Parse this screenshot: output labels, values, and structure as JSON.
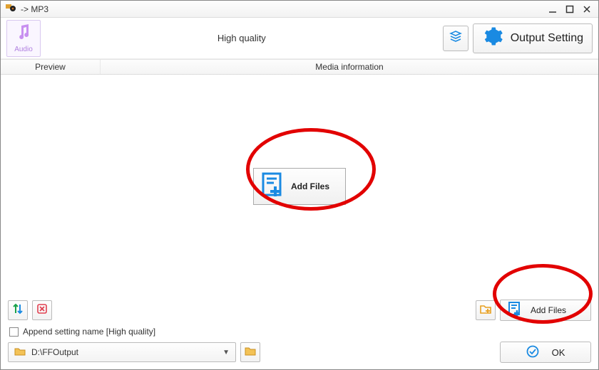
{
  "titlebar": {
    "title": "-> MP3"
  },
  "toolbar": {
    "audio_label": "Audio",
    "quality": "High quality",
    "output_setting": "Output Setting"
  },
  "headers": {
    "preview": "Preview",
    "media": "Media information"
  },
  "main": {
    "add_files": "Add Files"
  },
  "bottom": {
    "add_files": "Add Files",
    "append_label": "Append setting name [High quality]",
    "path": "D:\\FFOutput",
    "ok": "OK"
  }
}
